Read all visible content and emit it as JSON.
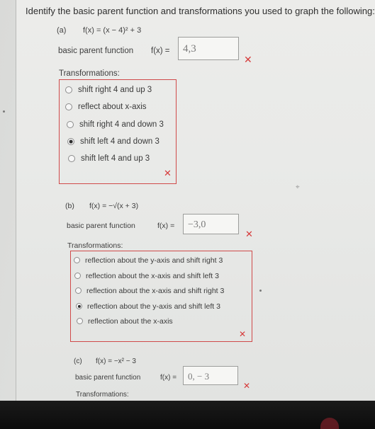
{
  "prompt": "Identify the basic parent function and transformations you used to graph the following:",
  "parts": [
    {
      "id": "a",
      "label": "(a)",
      "function": "f(x) = (x − 4)² + 3",
      "basic_label": "basic parent function",
      "fx_label": "f(x) =",
      "answer": "4,3",
      "transformations_label": "Transformations:",
      "options": [
        {
          "label": "shift right 4 and up 3",
          "selected": false
        },
        {
          "label": "reflect about x-axis",
          "selected": false
        },
        {
          "label": "shift right 4 and down 3",
          "selected": false
        },
        {
          "label": "shift left 4 and down 3",
          "selected": true
        },
        {
          "label": "shift left 4 and up 3",
          "selected": false
        }
      ],
      "answer_status": "incorrect",
      "options_status": "incorrect"
    },
    {
      "id": "b",
      "label": "(b)",
      "function": "f(x) = −√(x + 3)",
      "basic_label": "basic parent function",
      "fx_label": "f(x) =",
      "answer": "−3,0",
      "transformations_label": "Transformations:",
      "options": [
        {
          "label": "reflection about the y-axis and shift right 3",
          "selected": false
        },
        {
          "label": "reflection about the x-axis and shift left 3",
          "selected": false
        },
        {
          "label": "reflection about the x-axis and shift right 3",
          "selected": false
        },
        {
          "label": "reflection about the y-axis and shift left 3",
          "selected": true
        },
        {
          "label": "reflection about the x-axis",
          "selected": false
        }
      ],
      "answer_status": "incorrect",
      "options_status": "incorrect"
    },
    {
      "id": "c",
      "label": "(c)",
      "function": "f(x) = −x² − 3",
      "basic_label": "basic parent function",
      "fx_label": "f(x) =",
      "answer": "0, − 3",
      "transformations_label": "Transformations:",
      "answer_status": "incorrect"
    }
  ],
  "icons": {
    "incorrect": "x-mark-icon",
    "incorrect_color": "#d63a3a",
    "radio_selected": "radio-selected",
    "radio_unselected": "radio-unselected"
  }
}
